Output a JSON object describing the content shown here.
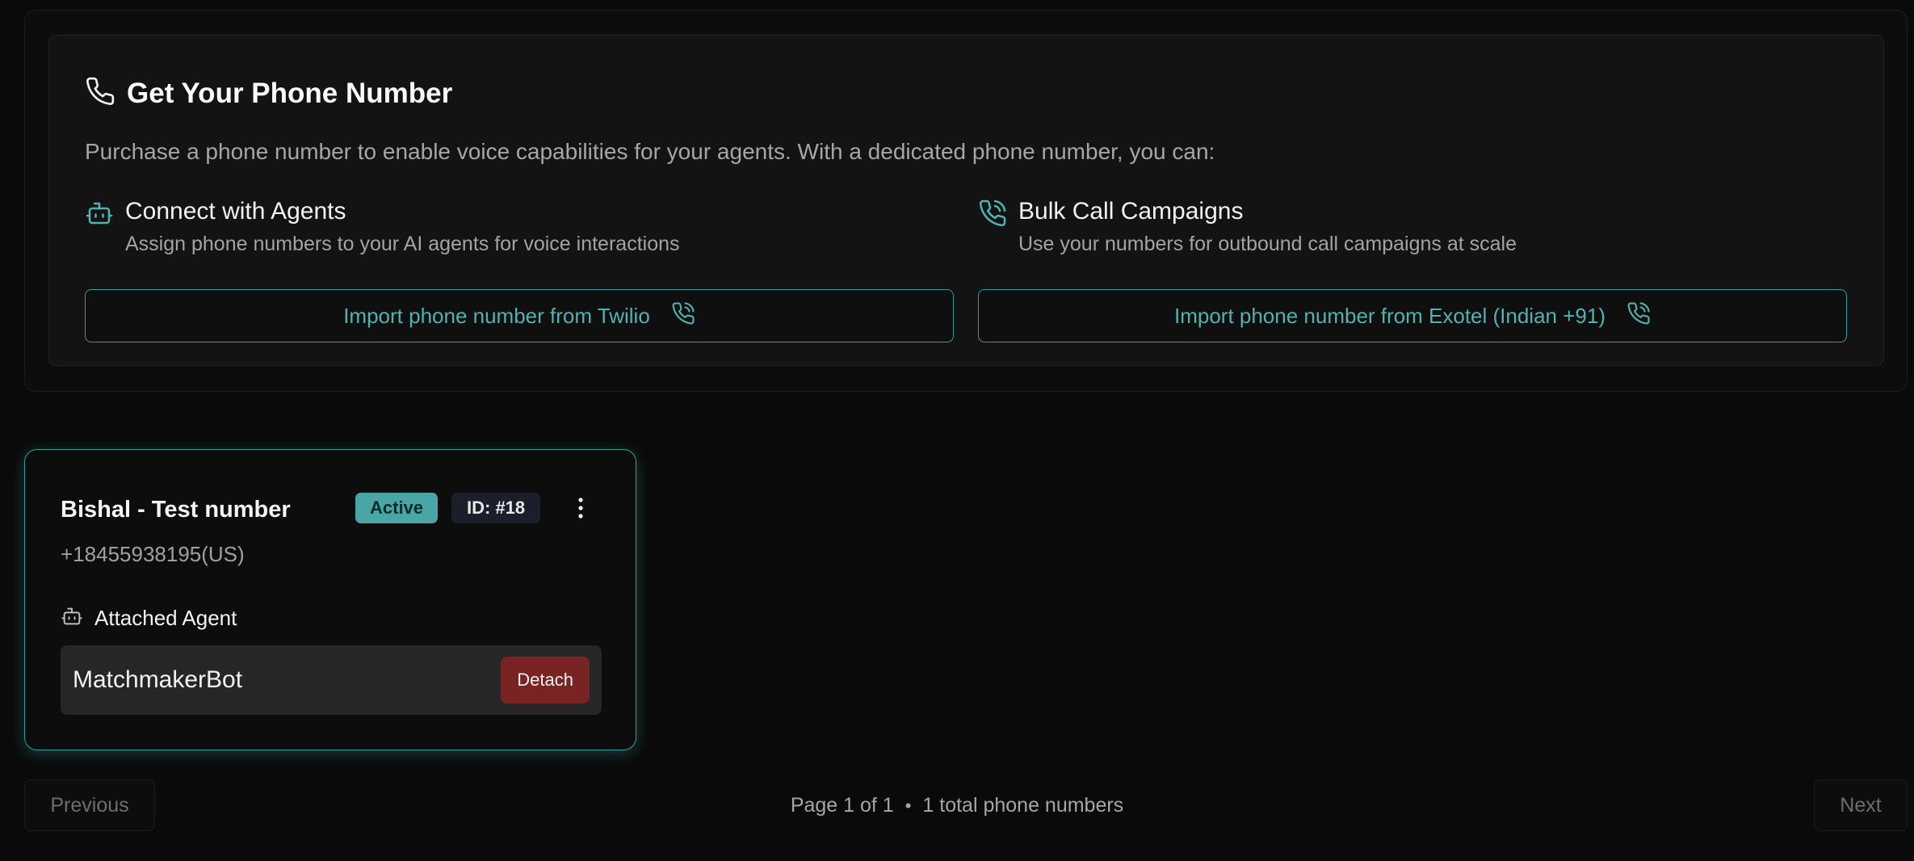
{
  "header": {
    "title": "Get Your Phone Number",
    "intro": "Purchase a phone number to enable voice capabilities for your agents. With a dedicated phone number, you can:"
  },
  "features": [
    {
      "title": "Connect with Agents",
      "description": "Assign phone numbers to your AI agents for voice interactions",
      "icon": "bot-icon"
    },
    {
      "title": "Bulk Call Campaigns",
      "description": "Use your numbers for outbound call campaigns at scale",
      "icon": "phone-call-icon"
    }
  ],
  "import_buttons": {
    "twilio": "Import phone number from Twilio",
    "exotel": "Import phone number from Exotel (Indian +91)"
  },
  "numbers": [
    {
      "name": "Bishal - Test number",
      "status": "Active",
      "id_label": "ID: #18",
      "phone": "+18455938195(US)",
      "attached_label": "Attached Agent",
      "agent_name": "MatchmakerBot",
      "detach_label": "Detach"
    }
  ],
  "pagination": {
    "previous": "Previous",
    "page_label": "Page 1 of 1",
    "separator": "•",
    "total_label": "1 total phone numbers",
    "next": "Next"
  },
  "colors": {
    "accent": "#4fb3b1",
    "active_badge": "#4aa6a4",
    "detach": "#7a2323",
    "background": "#0a0a0a"
  }
}
